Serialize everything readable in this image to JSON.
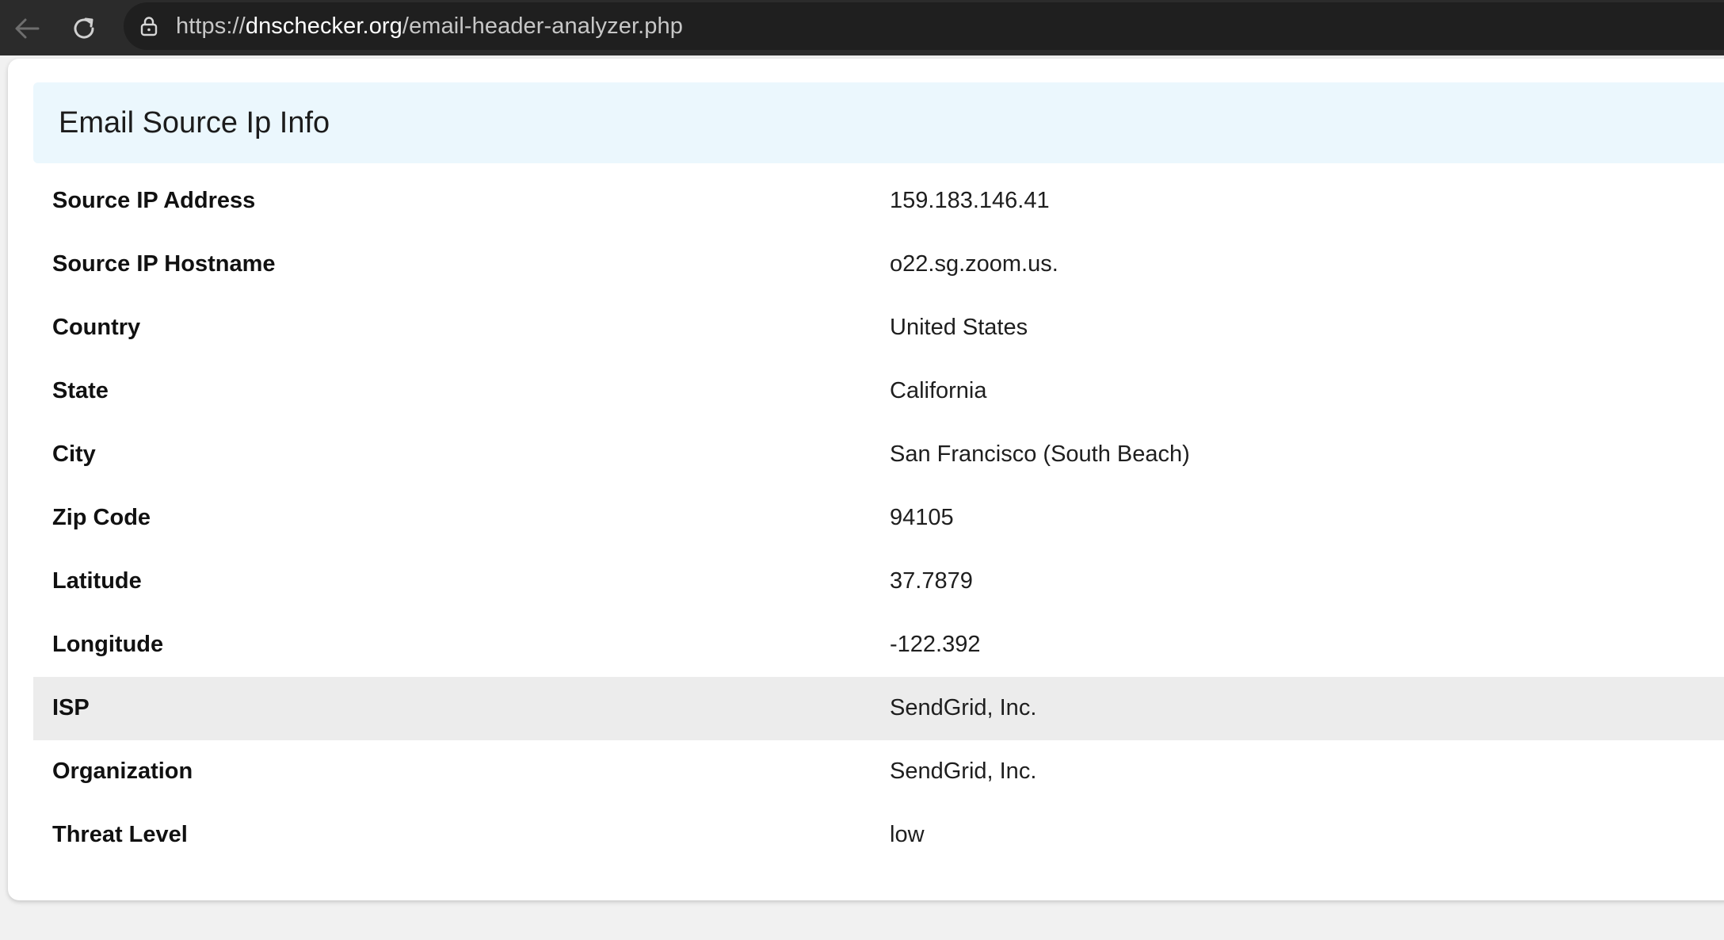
{
  "browser": {
    "url_prefix": "https://",
    "url_host": "dnschecker.org",
    "url_path": "/email-header-analyzer.php",
    "icons": {
      "back": "back-arrow-icon",
      "reload": "reload-icon",
      "site_info": "lock-icon"
    }
  },
  "section": {
    "title": "Email Source Ip Info",
    "header_bg": "#ebf7fd",
    "rows": [
      {
        "label": "Source IP Address",
        "value": "159.183.146.41"
      },
      {
        "label": "Source IP Hostname",
        "value": "o22.sg.zoom.us."
      },
      {
        "label": "Country",
        "value": "United States"
      },
      {
        "label": "State",
        "value": "California"
      },
      {
        "label": "City",
        "value": "San Francisco (South Beach)"
      },
      {
        "label": "Zip Code",
        "value": "94105"
      },
      {
        "label": "Latitude",
        "value": "37.7879"
      },
      {
        "label": "Longitude",
        "value": "-122.392"
      },
      {
        "label": "ISP",
        "value": "SendGrid, Inc."
      },
      {
        "label": "Organization",
        "value": "SendGrid, Inc."
      },
      {
        "label": "Threat Level",
        "value": "low"
      }
    ]
  }
}
